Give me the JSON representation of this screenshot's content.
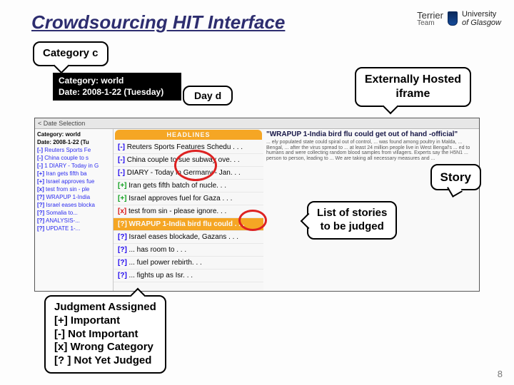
{
  "slide": {
    "title": "Crowdsourcing HIT Interface",
    "page_number": "8"
  },
  "logos": {
    "terrier_name": "Terrier",
    "terrier_sub": "Team",
    "uog_line1": "University",
    "uog_line2": "of Glasgow"
  },
  "callouts": {
    "category": "Category c",
    "day": "Day d",
    "iframe": "Externally Hosted\niframe",
    "story": "Story",
    "list": "List of stories\nto be judged",
    "judgment_title": "Judgment  Assigned",
    "judgment_rows": [
      "[+] Important",
      "[-] Not Important",
      "[x] Wrong Category",
      "[? ] Not Yet Judged"
    ]
  },
  "context_bar": {
    "category_label": "Category:",
    "category_value": "world",
    "date_label": "Date:",
    "date_value": "2008-1-22 (Tuesday)"
  },
  "iframe_mock": {
    "topbar": "< Date Selection",
    "left_meta": {
      "category": "Category: world",
      "date": "Date: 2008-1-22 (Tu"
    },
    "left_items": [
      {
        "tag": "[-]",
        "text": "Reuters Sports Fe"
      },
      {
        "tag": "[-]",
        "text": "China couple to s"
      },
      {
        "tag": "[-]",
        "text": "1 DIARY - Today in G"
      },
      {
        "tag": "[+]",
        "text": "Iran gets fifth ba"
      },
      {
        "tag": "[+]",
        "text": "Israel approves fue"
      },
      {
        "tag": "[x]",
        "text": "test from sin - ple"
      },
      {
        "tag": "[?]",
        "text": "WRAPUP 1-India"
      },
      {
        "tag": "[?]",
        "text": "Israel eases blocka"
      },
      {
        "tag": "[?]",
        "text": "Somalia to..."
      },
      {
        "tag": "[?]",
        "text": "ANALYSIS-..."
      },
      {
        "tag": "[?]",
        "text": "UPDATE 1-..."
      }
    ],
    "headlines_label": "HEADLINES",
    "headlines": [
      {
        "cls": "hl-minus",
        "tag": "[-]",
        "text": "Reuters Sports Features Schedu . . ."
      },
      {
        "cls": "hl-minus",
        "tag": "[-]",
        "text": "China couple to sue subway ove. . ."
      },
      {
        "cls": "hl-minus",
        "tag": "[-]",
        "text": "DIARY - Today in Germany - Jan. . ."
      },
      {
        "cls": "hl-plus",
        "tag": "[+]",
        "text": "Iran gets fifth batch of nucle. . ."
      },
      {
        "cls": "hl-plus",
        "tag": "[+]",
        "text": "Israel approves fuel for Gaza . . ."
      },
      {
        "cls": "hl-x",
        "tag": "[x]",
        "text": "test from sin - please ignore. . ."
      },
      {
        "cls": "hl-sel",
        "tag": "[?]",
        "text": "WRAPUP 1-India bird flu could . . ."
      },
      {
        "cls": "hl-minus",
        "tag": "[?]",
        "text": "Israel eases blockade, Gazans . . ."
      },
      {
        "cls": "hl-minus",
        "tag": "[?]",
        "text": "... has room to . . ."
      },
      {
        "cls": "hl-minus",
        "tag": "[?]",
        "text": "... fuel power rebirth. . ."
      },
      {
        "cls": "hl-minus",
        "tag": "[?]",
        "text": "... fights up as Isr. . ."
      }
    ],
    "story_title": "\"WRAPUP 1-India bird flu could get out of hand -official\"",
    "story_body": "... ely populated state could spiral out of control, ... was found among poultry in Malda, ... Bengal, ... after the virus spread to ... at least 24 million people live in West Bengal's ... ed to humans and were collecting random blood samples from villagers. Experts say the H5N1 ... person to person, leading to ... We are taking all necessary measures and ..."
  }
}
